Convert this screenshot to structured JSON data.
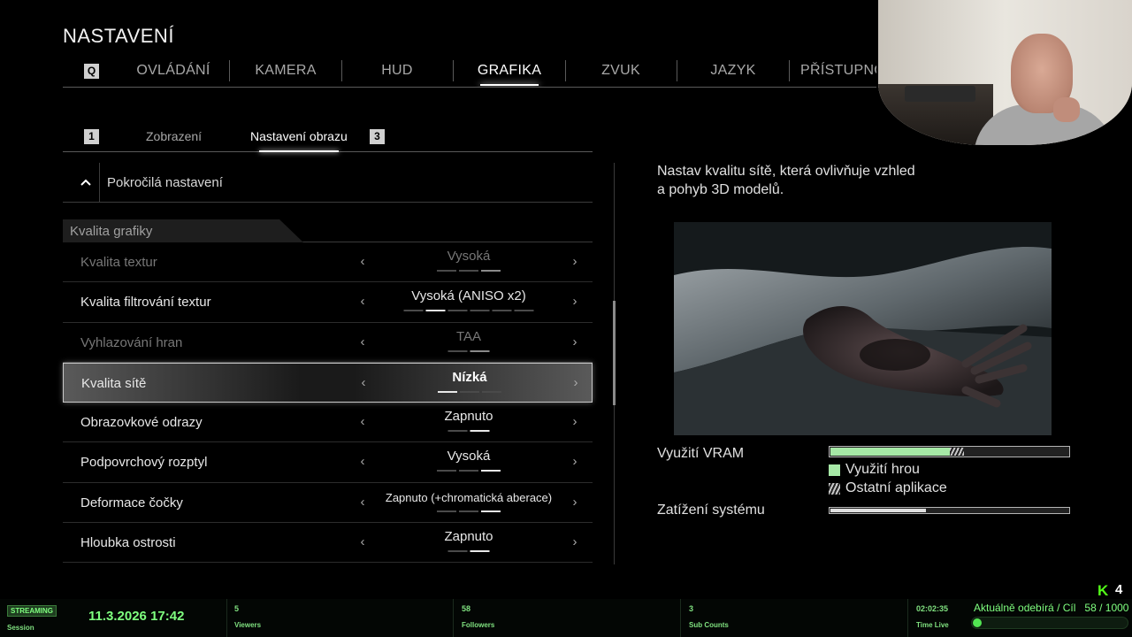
{
  "page_title": "NASTAVENÍ",
  "top_nav": {
    "key_left": "Q",
    "tabs": [
      "OVLÁDÁNÍ",
      "KAMERA",
      "HUD",
      "GRAFIKA",
      "ZVUK",
      "JAZYK",
      "PŘÍSTUPNOST"
    ],
    "active": "GRAFIKA"
  },
  "sub_nav": {
    "key_left": "1",
    "tabs": [
      "Zobrazení",
      "Nastavení obrazu"
    ],
    "active": "Nastavení obrazu",
    "key_right": "3"
  },
  "advanced": {
    "label": "Pokročilá nastavení",
    "icon": "chevron-up-icon"
  },
  "section": {
    "label": "Kvalita grafiky"
  },
  "settings": [
    {
      "name": "Kvalita textur",
      "value": "Vysoká",
      "pips": 3,
      "level": 3,
      "state": "disabled"
    },
    {
      "name": "Kvalita filtrování textur",
      "value": "Vysoká (ANISO x2)",
      "pips": 6,
      "level": 2,
      "state": "normal"
    },
    {
      "name": "Vyhlazování hran",
      "value": "TAA",
      "pips": 2,
      "level": 2,
      "state": "disabled"
    },
    {
      "name": "Kvalita sítě",
      "value": "Nízká",
      "pips": 3,
      "level": 1,
      "state": "selected"
    },
    {
      "name": "Obrazovkové odrazy",
      "value": "Zapnuto",
      "pips": 2,
      "level": 2,
      "state": "normal"
    },
    {
      "name": "Podpovrchový rozptyl",
      "value": "Vysoká",
      "pips": 3,
      "level": 3,
      "state": "normal"
    },
    {
      "name": "Deformace čočky",
      "value": "Zapnuto (+chromatická aberace)",
      "pips": 3,
      "level": 3,
      "state": "normal"
    },
    {
      "name": "Hloubka ostrosti",
      "value": "Zapnuto",
      "pips": 2,
      "level": 2,
      "state": "normal"
    }
  ],
  "description": "Nastav kvalitu sítě, která ovlivňuje vzhled a pohyb 3D modelů.",
  "vram": {
    "label": "Využití VRAM",
    "game_fraction": 0.5,
    "other_fraction": 0.06,
    "legend_game": "Využití hrou",
    "legend_other": "Ostatní aplikace",
    "game_color": "#a6e8a6"
  },
  "system_load": {
    "label": "Zatížení systému",
    "fraction": 0.4
  },
  "stream_overlay": {
    "badge": "STREAMING",
    "session_label": "Session",
    "datetime": "11.3.2026 17:42",
    "viewers_count": "5",
    "viewers_label": "Viewers",
    "followers_count": "58",
    "followers_label": "Followers",
    "subs_count": "3",
    "subs_label": "Sub Counts",
    "time_live": "02:02:35",
    "time_live_label": "Time Live",
    "sub_goal_text": "Aktuálně odebírá / Cíl",
    "sub_goal_value": "58 / 1000",
    "sub_goal_fraction": 0.058,
    "kick_logo": "K",
    "kick_count": "4",
    "accent": "#7fff7f"
  }
}
